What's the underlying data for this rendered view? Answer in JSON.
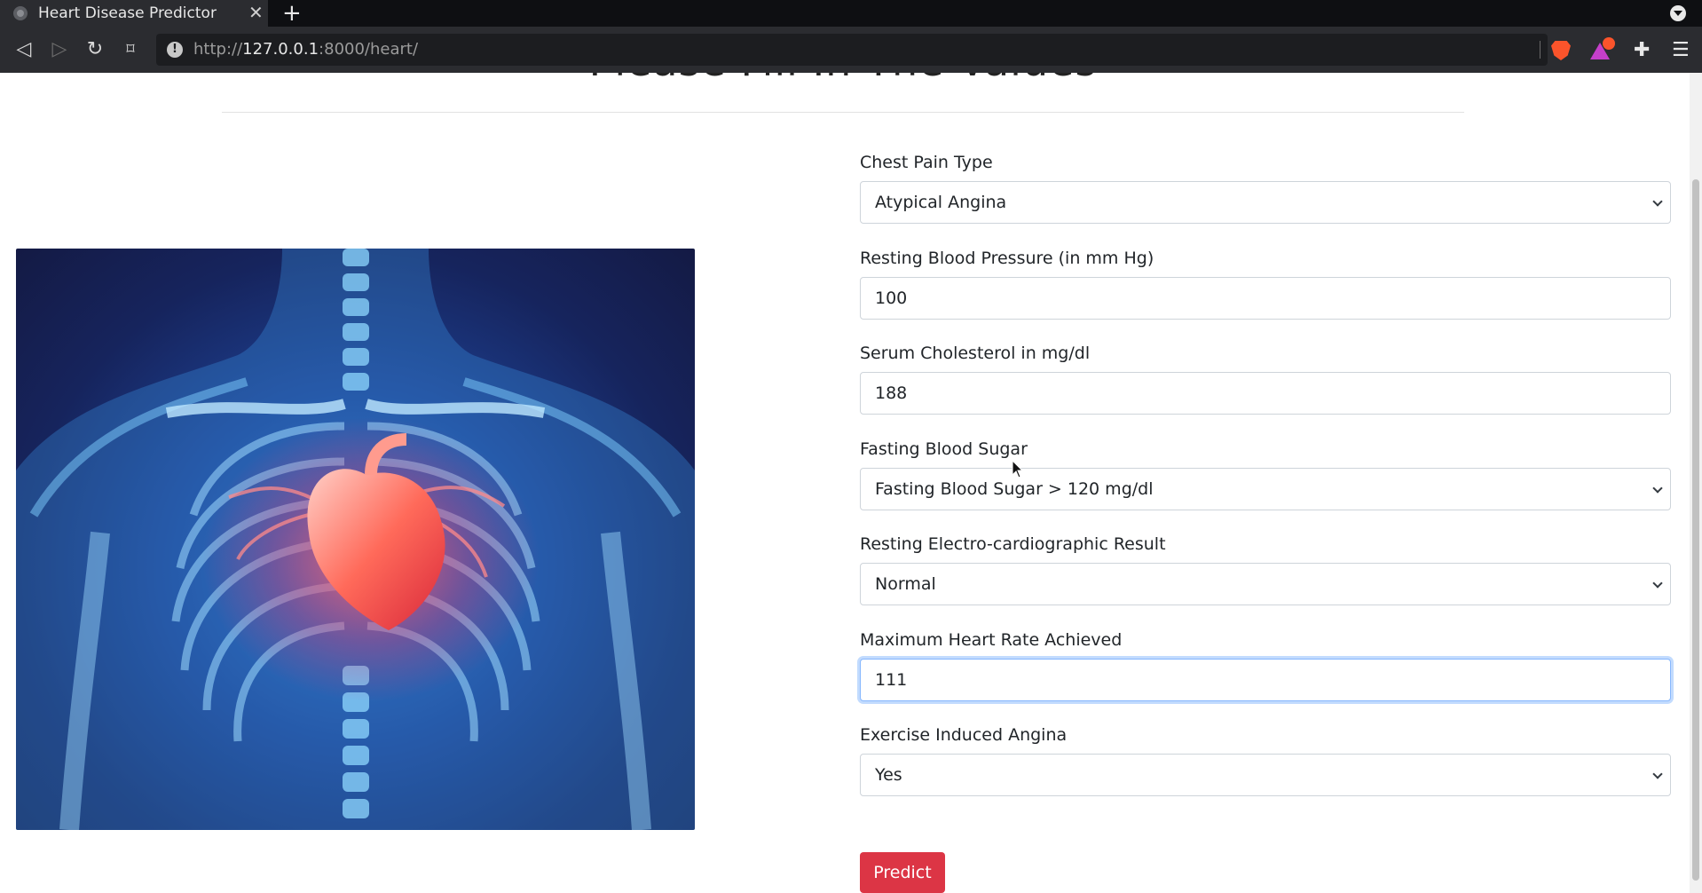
{
  "browser": {
    "tab_title": "Heart Disease Predictor",
    "tab_close": "✕",
    "new_tab": "+",
    "url_prefix": "http://",
    "url_host": "127.0.0.1",
    "url_rest": ":8000/heart/"
  },
  "page": {
    "title": "Please Fill In The Values",
    "hero_image_alt": "heart-xray-illustration"
  },
  "form": {
    "fields": [
      {
        "label": "Chest Pain Type",
        "type": "select",
        "value": "Atypical Angina"
      },
      {
        "label": "Resting Blood Pressure (in mm Hg)",
        "type": "input",
        "value": "100"
      },
      {
        "label": "Serum Cholesterol in mg/dl",
        "type": "input",
        "value": "188"
      },
      {
        "label": "Fasting Blood Sugar",
        "type": "select",
        "value": "Fasting Blood Sugar > 120 mg/dl"
      },
      {
        "label": "Resting Electro-cardiographic Result",
        "type": "select",
        "value": "Normal"
      },
      {
        "label": "Maximum Heart Rate Achieved",
        "type": "input",
        "value": "111",
        "focused": true
      },
      {
        "label": "Exercise Induced Angina",
        "type": "select",
        "value": "Yes"
      }
    ],
    "submit_label": "Predict"
  },
  "colors": {
    "accent_button": "#dc3545",
    "focus_border": "#86b7fe",
    "browser_dark": "#2b2c30"
  }
}
